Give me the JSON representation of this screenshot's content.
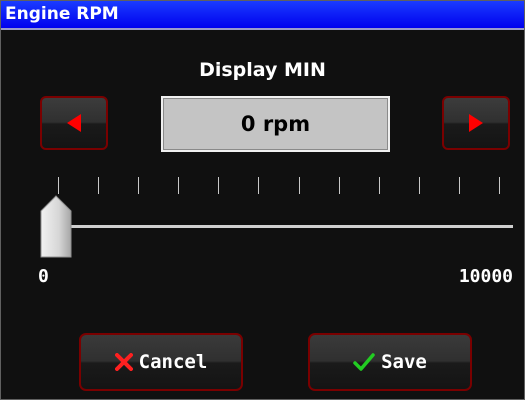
{
  "window": {
    "title": "Engine RPM"
  },
  "setting": {
    "heading": "Display MIN",
    "value_text": "0 rpm",
    "slider_value": 0,
    "slider_min": 0,
    "slider_max": 10000,
    "min_label": "0",
    "max_label": "10000",
    "tick_count": 12
  },
  "controls": {
    "decrease_icon": "triangle-left-icon",
    "increase_icon": "triangle-right-icon"
  },
  "actions": {
    "cancel_label": "Cancel",
    "cancel_icon": "x-icon",
    "save_label": "Save",
    "save_icon": "checkmark-icon"
  },
  "colors": {
    "titlebar": "#0000ee",
    "background": "#101010",
    "button_border": "#7a0000",
    "arrow": "#ff0000",
    "cancel_icon": "#ff2020",
    "save_icon": "#22cc22"
  }
}
